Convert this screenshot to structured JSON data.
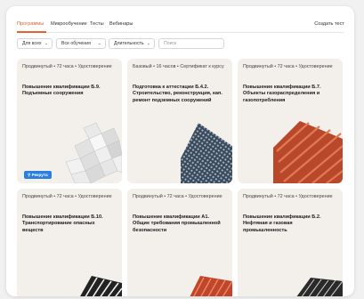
{
  "tabs": [
    {
      "label": "Программы",
      "active": true
    },
    {
      "label": "Микрообучение",
      "active": false
    },
    {
      "label": "Тесты",
      "active": false
    },
    {
      "label": "Вебинары",
      "active": false
    }
  ],
  "create_test_label": "Создать тест",
  "filters": {
    "selects": [
      {
        "value": "Для всех"
      },
      {
        "value": "Все обучения"
      },
      {
        "value": "Длительность"
      }
    ],
    "search_placeholder": "Поиск"
  },
  "cards": [
    {
      "meta": "Продвинутый • 72 часа • Удостоверение",
      "title": "Повышение квалификации Б.9. Подъемные сооружения",
      "badge": "Рекрута"
    },
    {
      "meta": "Базовый • 16 часов • Сертификат к курсу",
      "title": "Подготовка к аттестации Б.4.2. Строительство, реконструкция, кап. ремонт подземных сооружений"
    },
    {
      "meta": "Продвинутый • 72 часа • Удостоверение",
      "title": "Повышение квалификации Б.7. Объекты газораспределения и газопотребления"
    },
    {
      "meta": "Продвинутый • 72 часа • Удостоверение",
      "title": "Повышение квалификации Б.10. Транспортирование опасных веществ"
    },
    {
      "meta": "Продвинутый • 72 часа • Удостоверение",
      "title": "Повышение квалификации А1. Общие требования промышленной безопасности"
    },
    {
      "meta": "Продвинутый • 72 часа • Удостоверение",
      "title": "Повышение квалификации Б.2. Нефтяная и газовая промышленность"
    }
  ],
  "colors": {
    "accent": "#e8602c",
    "badge": "#2a7fe0",
    "card_bg": "#f3f0ec"
  }
}
